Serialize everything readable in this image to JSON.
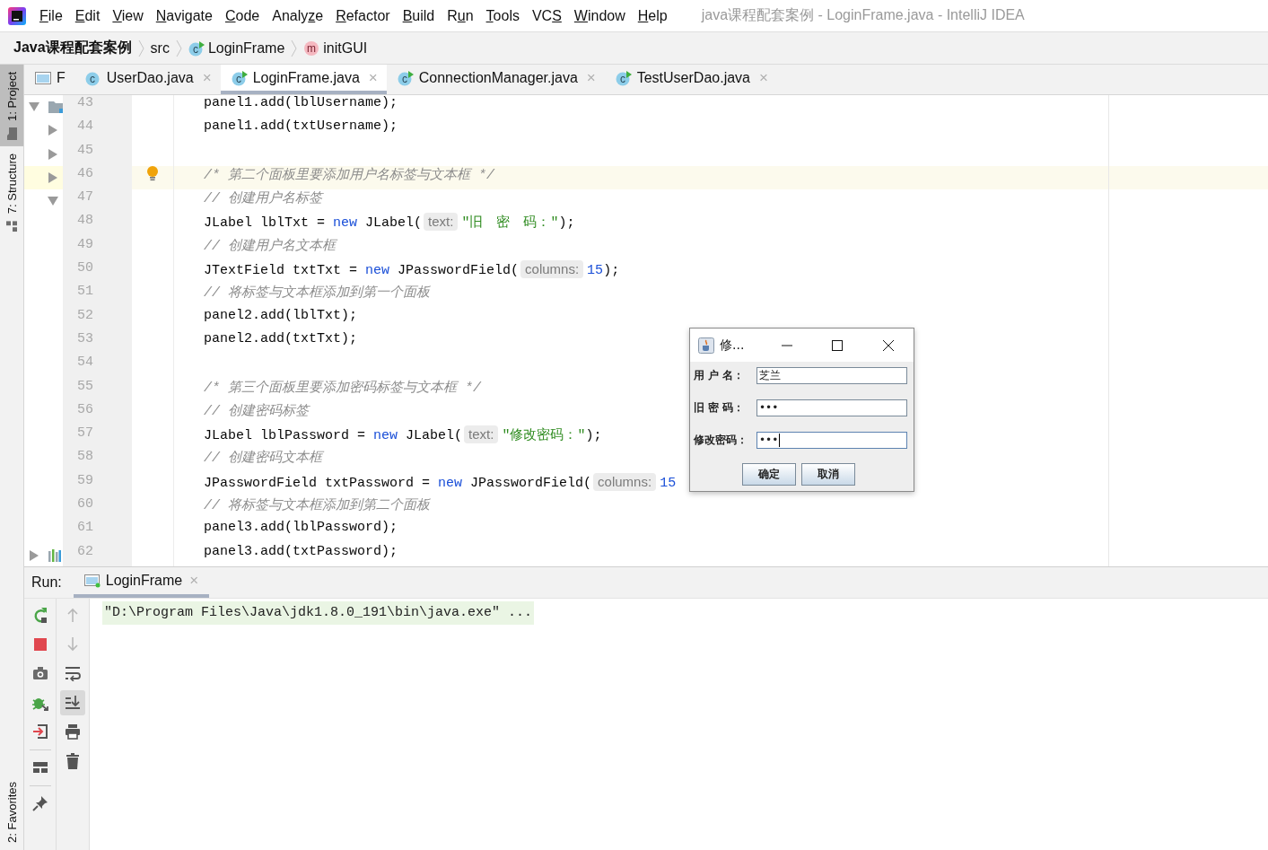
{
  "menu": {
    "items": [
      {
        "key": "F",
        "after": "ile"
      },
      {
        "key": "E",
        "after": "dit"
      },
      {
        "key": "V",
        "after": "iew"
      },
      {
        "key": "N",
        "after": "avigate"
      },
      {
        "key": "C",
        "after": "ode"
      },
      {
        "before": "Analy",
        "key": "z",
        "after": "e"
      },
      {
        "key": "R",
        "after": "efactor"
      },
      {
        "key": "B",
        "after": "uild"
      },
      {
        "before": "R",
        "key": "u",
        "after": "n"
      },
      {
        "key": "T",
        "after": "ools"
      },
      {
        "before": "VC",
        "key": "S"
      },
      {
        "key": "W",
        "after": "indow"
      },
      {
        "key": "H",
        "after": "elp"
      }
    ],
    "title": "java课程配套案例 - LoginFrame.java - IntelliJ IDEA"
  },
  "breadcrumbs": [
    {
      "text": "Java课程配套案例",
      "kind": "project"
    },
    {
      "text": "src",
      "kind": "folder"
    },
    {
      "text": "LoginFrame",
      "kind": "class",
      "icon_letter": "c",
      "runnable": true
    },
    {
      "text": "initGUI",
      "kind": "method",
      "icon_letter": "m"
    }
  ],
  "side_tools": [
    {
      "label": "1: Project",
      "kind": "project",
      "selected": true
    },
    {
      "label": "7: Structure",
      "kind": "structure",
      "selected": false
    }
  ],
  "favorites": {
    "label": "2: Favorites"
  },
  "editor_tabs": [
    {
      "label": "F",
      "kind": "form",
      "selected": false
    },
    {
      "label": "UserDao.java",
      "kind": "class",
      "icon_letter": "c",
      "runnable": false,
      "close": "×",
      "selected": false
    },
    {
      "label": "LoginFrame.java",
      "kind": "class",
      "icon_letter": "c",
      "runnable": true,
      "close": "×",
      "selected": true
    },
    {
      "label": "ConnectionManager.java",
      "kind": "class",
      "icon_letter": "c",
      "runnable": true,
      "close": "×",
      "selected": false
    },
    {
      "label": "TestUserDao.java",
      "kind": "class",
      "icon_letter": "c",
      "runnable": true,
      "close": "×",
      "selected": false
    }
  ],
  "project_tree": [
    {
      "kind": "folder",
      "expanded": true,
      "children": [
        {
          "expanded": false
        },
        {
          "expanded": false
        },
        {
          "expanded": false
        },
        {
          "expanded": true
        }
      ]
    },
    {
      "kind": "library",
      "expanded": false
    }
  ],
  "code_lines": [
    {
      "number": "43",
      "current": false,
      "tokens": [
        {
          "kind": "plain",
          "text": "panel1.add(lblUsername);"
        }
      ]
    },
    {
      "number": "44",
      "current": false,
      "tokens": [
        {
          "kind": "plain",
          "text": "panel1.add(txtUsername);"
        }
      ]
    },
    {
      "number": "45",
      "current": false
    },
    {
      "number": "46",
      "current": true,
      "bulb": true,
      "tokens": [
        {
          "kind": "comment",
          "text": "/* 第二个面板里要添加用户名标签与文本框 */"
        }
      ]
    },
    {
      "number": "47",
      "current": false,
      "tokens": [
        {
          "kind": "comment",
          "text": "// 创建用户名标签"
        }
      ]
    },
    {
      "number": "48",
      "current": false,
      "tokens": [
        {
          "kind": "plain",
          "text": "JLabel lblTxt = "
        },
        {
          "kind": "keyword",
          "text": "new"
        },
        {
          "kind": "plain",
          "text": " JLabel("
        },
        {
          "kind": "hint",
          "text": "text:"
        },
        {
          "kind": "string",
          "text": "\"旧　密　码：\""
        },
        {
          "kind": "plain",
          "text": ");"
        }
      ]
    },
    {
      "number": "49",
      "current": false,
      "tokens": [
        {
          "kind": "comment",
          "text": "// 创建用户名文本框"
        }
      ]
    },
    {
      "number": "50",
      "current": false,
      "tokens": [
        {
          "kind": "plain",
          "text": "JTextField txtTxt = "
        },
        {
          "kind": "keyword",
          "text": "new"
        },
        {
          "kind": "plain",
          "text": " JPasswordField("
        },
        {
          "kind": "hint",
          "text": "columns:"
        },
        {
          "kind": "number",
          "text": "15"
        },
        {
          "kind": "plain",
          "text": ");"
        }
      ]
    },
    {
      "number": "51",
      "current": false,
      "tokens": [
        {
          "kind": "comment",
          "text": "// 将标签与文本框添加到第一个面板"
        }
      ]
    },
    {
      "number": "52",
      "current": false,
      "tokens": [
        {
          "kind": "plain",
          "text": "panel2.add(lblTxt);"
        }
      ]
    },
    {
      "number": "53",
      "current": false,
      "tokens": [
        {
          "kind": "plain",
          "text": "panel2.add(txtTxt);"
        }
      ]
    },
    {
      "number": "54",
      "current": false
    },
    {
      "number": "55",
      "current": false,
      "tokens": [
        {
          "kind": "comment",
          "text": "/* 第三个面板里要添加密码标签与文本框 */"
        }
      ]
    },
    {
      "number": "56",
      "current": false,
      "tokens": [
        {
          "kind": "comment",
          "text": "// 创建密码标签"
        }
      ]
    },
    {
      "number": "57",
      "current": false,
      "tokens": [
        {
          "kind": "plain",
          "text": "JLabel lblPassword = "
        },
        {
          "kind": "keyword",
          "text": "new"
        },
        {
          "kind": "plain",
          "text": " JLabel("
        },
        {
          "kind": "hint",
          "text": "text:"
        },
        {
          "kind": "string",
          "text": "\"修改密码：\""
        },
        {
          "kind": "plain",
          "text": ");"
        }
      ]
    },
    {
      "number": "58",
      "current": false,
      "tokens": [
        {
          "kind": "comment",
          "text": "// 创建密码文本框"
        }
      ]
    },
    {
      "number": "59",
      "current": false,
      "tokens": [
        {
          "kind": "plain",
          "text": "JPasswordField txtPassword = "
        },
        {
          "kind": "keyword",
          "text": "new"
        },
        {
          "kind": "plain",
          "text": " JPasswordField("
        },
        {
          "kind": "hint",
          "text": "columns:"
        },
        {
          "kind": "number",
          "text": "15"
        }
      ]
    },
    {
      "number": "60",
      "current": false,
      "tokens": [
        {
          "kind": "comment",
          "text": "// 将标签与文本框添加到第二个面板"
        }
      ]
    },
    {
      "number": "61",
      "current": false,
      "tokens": [
        {
          "kind": "plain",
          "text": "panel3.add(lblPassword);"
        }
      ]
    },
    {
      "number": "62",
      "current": false,
      "tokens": [
        {
          "kind": "plain",
          "text": "panel3.add(txtPassword);"
        }
      ]
    }
  ],
  "run": {
    "label": "Run:",
    "tab": {
      "label": "LoginFrame",
      "close": "×",
      "selected": true
    },
    "scroll_to_end": {
      "on": true
    },
    "console": [
      "\"D:\\Program Files\\Java\\jdk1.8.0_191\\bin\\java.exe\" ..."
    ]
  },
  "dialog": {
    "title": "修...",
    "fields": [
      {
        "label": "用 户 名：",
        "value": "芝兰",
        "focused": false
      },
      {
        "label": "旧 密 码：",
        "value": "•••",
        "focused": false
      },
      {
        "label": "修改密码：",
        "value": "•••",
        "focused": true
      }
    ],
    "buttons": [
      "确定",
      "取消"
    ]
  }
}
